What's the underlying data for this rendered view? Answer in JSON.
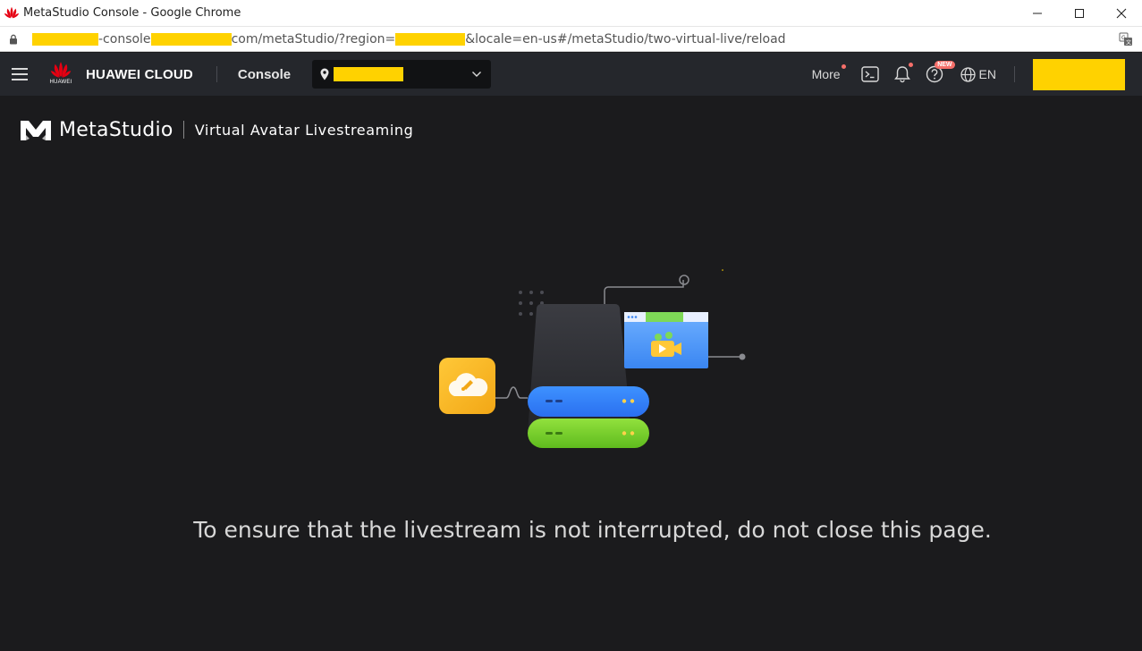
{
  "browser": {
    "window_title": "MetaStudio Console - Google Chrome",
    "url_parts": [
      "-console",
      "com/metaStudio/?region=",
      "&locale=en-us#/metaStudio/two-virtual-live/reload"
    ],
    "controls": {
      "minimize": "—",
      "maximize": "☐",
      "close": "✕"
    }
  },
  "header": {
    "brand_sub": "HUAWEI",
    "brand_name": "HUAWEI CLOUD",
    "console_label": "Console",
    "more_label": "More",
    "new_badge": "NEW",
    "lang_label": "EN"
  },
  "product": {
    "name": "MetaStudio",
    "page_title": "Virtual Avatar Livestreaming"
  },
  "main": {
    "message": "To ensure that the livestream is not interrupted, do not close this page."
  },
  "colors": {
    "redaction": "#ffd200",
    "header_bg": "#25272c",
    "page_bg": "#1b1b1d",
    "accent_red": "#f66f6a"
  }
}
